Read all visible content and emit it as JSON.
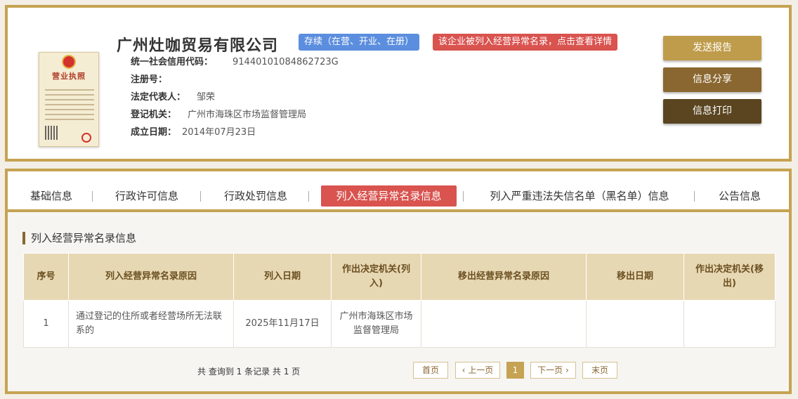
{
  "header": {
    "license_image": {
      "title": "营业执照"
    },
    "company_name": "广州灶咖贸易有限公司",
    "status_badge": "存续（在营、开业、在册）",
    "warning_badge": "该企业被列入经营异常名录，点击查看详情",
    "fields": [
      {
        "label": "统一社会信用代码：",
        "value": "91440101084862723G"
      },
      {
        "label": "注册号：",
        "value": ""
      },
      {
        "label": "法定代表人：",
        "value": "邹荣"
      },
      {
        "label": "登记机关：",
        "value": "广州市海珠区市场监督管理局"
      },
      {
        "label": "成立日期：",
        "value": "2014年07月23日"
      }
    ],
    "buttons": {
      "send_report": "发送报告",
      "share": "信息分享",
      "print": "信息打印"
    }
  },
  "tabs": [
    {
      "label": "基础信息",
      "active": false
    },
    {
      "label": "行政许可信息",
      "active": false
    },
    {
      "label": "行政处罚信息",
      "active": false
    },
    {
      "label": "列入经营异常名录信息",
      "active": true
    },
    {
      "label": "列入严重违法失信名单（黑名单）信息",
      "active": false
    },
    {
      "label": "公告信息",
      "active": false
    }
  ],
  "section": {
    "title": "列入经营异常名录信息",
    "columns": [
      "序号",
      "列入经营异常名录原因",
      "列入日期",
      "作出决定机关(列入)",
      "移出经营异常名录原因",
      "移出日期",
      "作出决定机关(移出)"
    ],
    "rows": [
      [
        "1",
        "通过登记的住所或者经营场所无法联系的",
        "2025年11月17日",
        "广州市海珠区市场监督管理局",
        "",
        "",
        ""
      ]
    ]
  },
  "pagination": {
    "summary": "共 查询到 1 条记录 共 1 页",
    "first": "首页",
    "prev": "上一页",
    "current": "1",
    "next": "下一页",
    "last": "末页"
  },
  "colors": {
    "accent": "#c5a352",
    "active_tab": "#d9534f",
    "status_blue": "#5b8ede"
  }
}
